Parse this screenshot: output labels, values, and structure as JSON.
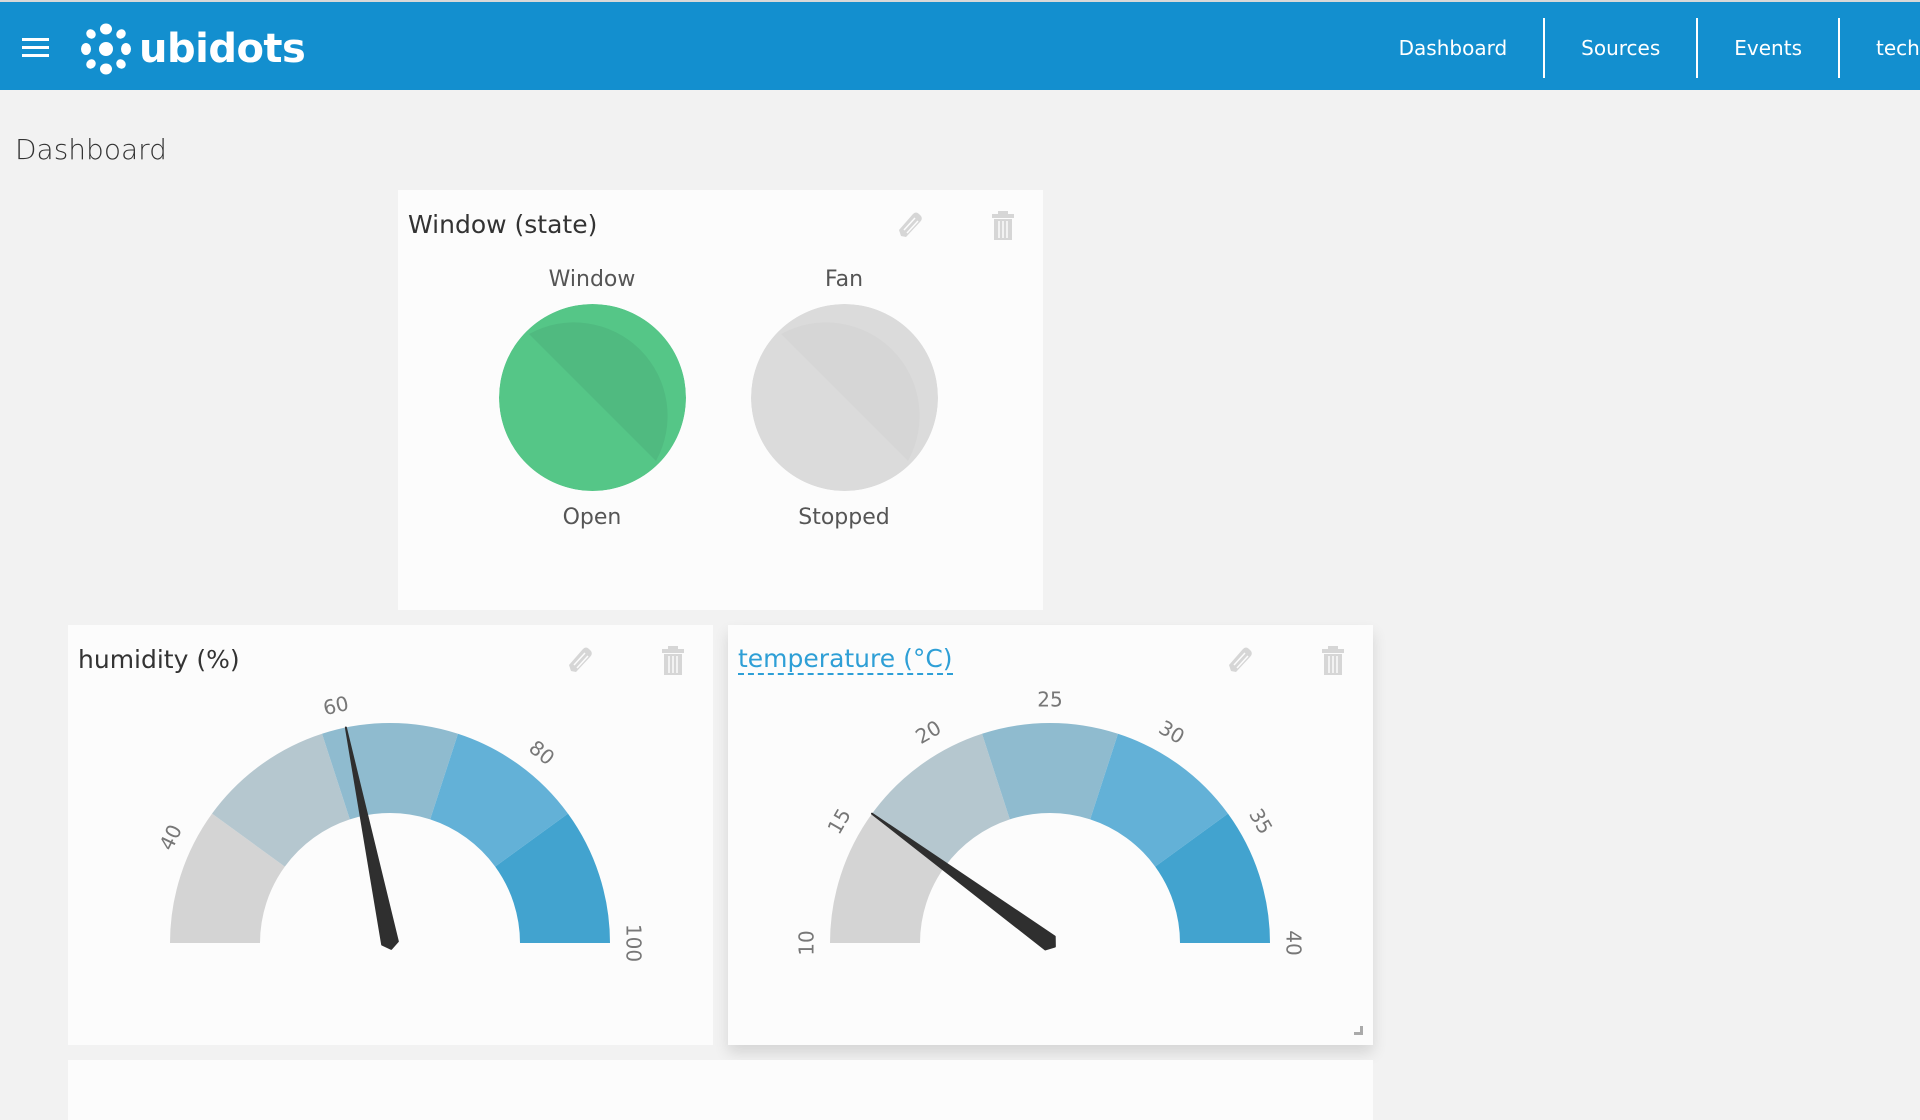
{
  "header": {
    "brand": "ubidots",
    "menu_icon": "hamburger-menu-icon",
    "logo_icon": "ubidots-dots-logo",
    "nav": [
      "Dashboard",
      "Sources",
      "Events",
      "techp"
    ],
    "color": "#138fcf"
  },
  "page": {
    "title": "Dashboard"
  },
  "widgets": {
    "window_state": {
      "title": "Window (state)",
      "edit_icon": "pencil-icon",
      "delete_icon": "trash-icon",
      "indicators": [
        {
          "label": "Window",
          "state": "Open",
          "color": "#52c484",
          "active": true
        },
        {
          "label": "Fan",
          "state": "Stopped",
          "color": "#d8d8d8",
          "active": false
        }
      ]
    },
    "humidity": {
      "title": "humidity (%)",
      "edit_icon": "pencil-icon",
      "delete_icon": "trash-icon"
    },
    "temperature": {
      "title": "temperature (°C)",
      "edit_icon": "pencil-icon",
      "delete_icon": "trash-icon"
    }
  },
  "chart_data": [
    {
      "type": "gauge",
      "title": "humidity (%)",
      "min": 30,
      "max": 100,
      "value": 60.5,
      "ticks": [
        40,
        60,
        80,
        100
      ],
      "band_colors": [
        "#d4d4d4",
        "#b5c7cf",
        "#8fbbcf",
        "#63b1d7",
        "#42a3cf"
      ]
    },
    {
      "type": "gauge",
      "title": "temperature (°C)",
      "min": 10,
      "max": 40,
      "value": 16,
      "ticks": [
        10,
        15,
        20,
        25,
        30,
        35,
        40
      ],
      "band_colors": [
        "#d4d4d4",
        "#b5c7cf",
        "#8fbbcf",
        "#63b1d7",
        "#42a3cf"
      ]
    }
  ]
}
